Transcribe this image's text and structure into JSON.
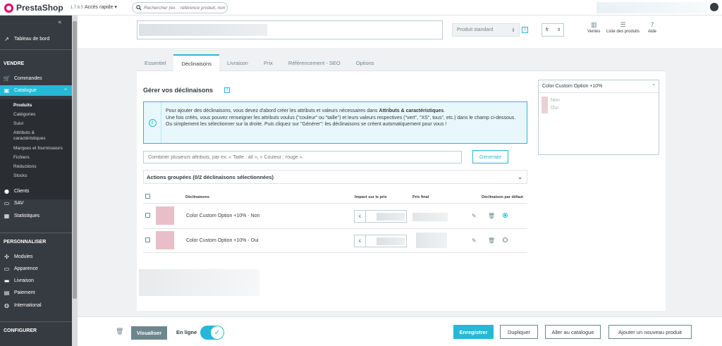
{
  "topbar": {
    "brand": "PrestaShop",
    "version": "1.7.6.5",
    "quick_access": "Accès rapide",
    "search_placeholder": "Rechercher (ex. : référence produit, nom"
  },
  "sidebar": {
    "dashboard": "Tableau de bord",
    "sections": {
      "sell": "VENDRE",
      "customize": "PERSONNALISER",
      "configure": "CONFIGURER"
    },
    "items": {
      "orders": "Commandes",
      "catalog": "Catalogue",
      "customers": "Clients",
      "service": "SAV",
      "stats": "Statistiques",
      "modules": "Modules",
      "design": "Apparence",
      "shipping": "Livraison",
      "payment": "Paiement",
      "international": "International"
    },
    "catalog_sub": [
      "Produits",
      "Catégories",
      "Suivi",
      "Attributs &",
      "caractéristiques",
      "Marques et fournisseurs",
      "Fichiers",
      "Réductions",
      "Stocks"
    ]
  },
  "header": {
    "product_type": "Produit standard",
    "lang": "fr",
    "tools": {
      "sales": "Ventes",
      "products_list": "Liste des produits",
      "help": "Aide"
    }
  },
  "tabs": [
    "Essentiel",
    "Déclinaisons",
    "Livraison",
    "Prix",
    "Référencement - SEO",
    "Options"
  ],
  "combinations": {
    "title": "Gérer vos déclinaisons",
    "alert_line1_pre": "Pour ajouter des déclinaisons, vous devez d'abord créer les attributs et valeurs nécessaires dans ",
    "alert_line1_bold": "Attributs & caractéristiques",
    "alert_line1_post": ".",
    "alert_rest": "Une fois créés, vous pouvez renseigner les attributs voulus (\"couleur\" ou \"taille\") et leurs valeurs respectives (\"vert\", \"XS\", tous\", etc.) dans le champ ci-dessous. Ou simplement les sélectionner sur la droite. Puis cliquez sur \"Générer\": les déclinaisons se créent automatiquement pour vous !",
    "combine_placeholder": "Combiner plusieurs attributs, par ex. « Taille : all », « Couleur : rouge ».",
    "generate": "Generate",
    "bulk_actions": "Actions groupées (0/2 déclinaisons sélectionnées)",
    "columns": {
      "name": "Déclinaisons",
      "impact": "Impact sur le prix",
      "final": "Prix final",
      "default": "Déclinaison par défaut"
    },
    "rows": [
      {
        "name": "Color Custom Option +10% - Non",
        "currency": "€",
        "default": true
      },
      {
        "name": "Color Custom Option +10% - Oui",
        "currency": "€",
        "default": false
      }
    ]
  },
  "attribute_panel": {
    "title": "Color Custom Option +10%",
    "options": [
      "Non",
      "Oui"
    ]
  },
  "footer": {
    "preview": "Visualiser",
    "online": "En ligne",
    "save": "Enregistrer",
    "duplicate": "Dupliquer",
    "go_catalog": "Aller au catalogue",
    "add_new": "Ajouter un nouveau produit"
  }
}
